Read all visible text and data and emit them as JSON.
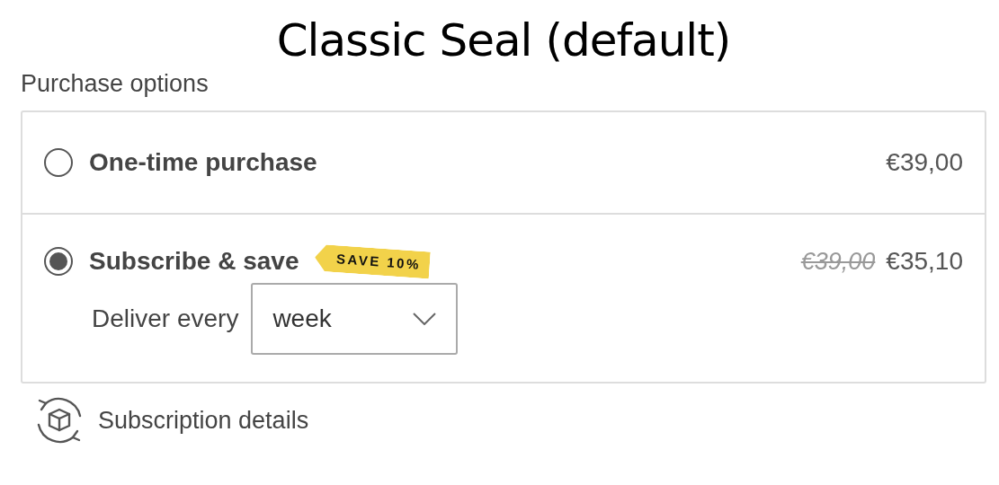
{
  "title": "Classic Seal (default)",
  "section_label": "Purchase options",
  "options": [
    {
      "kind": "single",
      "label": "One-time purchase",
      "selected": false,
      "price": "€39,00"
    },
    {
      "kind": "subscription",
      "label": "Subscribe & save",
      "selected": true,
      "badge": "SAVE 10%",
      "compare_price": "€39,00",
      "price": "€35,10",
      "frequency": {
        "label": "Deliver every",
        "value": "week"
      }
    }
  ],
  "details_link": "Subscription details"
}
